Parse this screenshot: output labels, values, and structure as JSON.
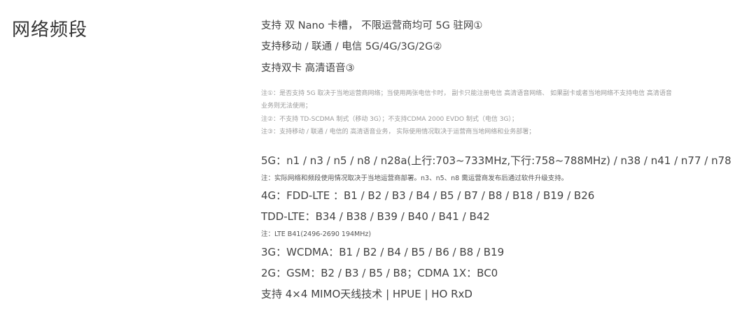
{
  "section": {
    "title": "网络频段"
  },
  "support": {
    "line1": "支持 双 Nano 卡槽， 不限运营商均可 5G 驻网①",
    "line2": "支持移动 / 联通 / 电信 5G/4G/3G/2G②",
    "line3": "支持双卡 高清语音③"
  },
  "notes": {
    "note1a": "注①：是否支持 5G 取决于当地运营商网络；当使用两张电信卡时， 副卡只能注册电信 高清语音网络、 如果副卡或者当地网络不支持电信 高清语音",
    "note1b": "业务则无法使用；",
    "note2": "注②：不支持 TD-SCDMA 制式（移动 3G）；不支持CDMA 2000 EVDO 制式（电信 3G）；",
    "note3": "注③：支持移动 / 联通 / 电信的 高清语音业务， 实际使用情况取决于运营商当地网络和业务部署；"
  },
  "bands": {
    "nr5g": "5G：n1 / n3 / n5 / n8 / n28a(上行:703~733MHz,下行:758~788MHz) / n38  / n41 / n77 / n78",
    "nr5g_note": "注：实际网络和频段使用情况取决于当地运营商部署。n3、n5、n8 需运营商发布后通过软件升级支持。",
    "lte_fdd": "4G：FDD-LTE ：B1 / B2 / B3 / B4 / B5 / B7 / B8 / B18 / B19 / B26",
    "lte_tdd": "TDD-LTE：B34 / B38 / B39 / B40 / B41 / B42",
    "lte_note": "注：LTE B41(2496-2690 194MHz)",
    "wcdma": "3G：WCDMA：B1 / B2 / B4 / B5 / B6 / B8 / B19",
    "gsm": "2G：GSM：B2 / B3 / B5 / B8；CDMA 1X：BC0",
    "mimo": "支持 4×4 MIMO天线技术 | HPUE | HO RxD"
  }
}
